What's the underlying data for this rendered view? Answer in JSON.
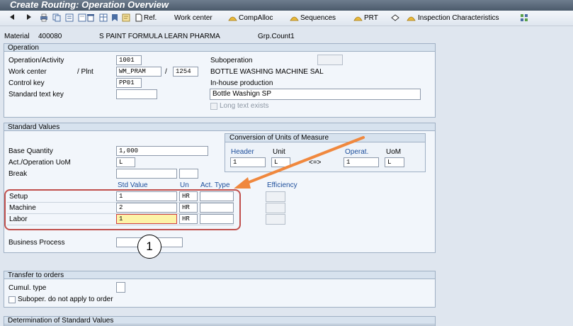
{
  "window": {
    "title": "Create Routing: Operation Overview"
  },
  "toolbar": {
    "ref_label": "Ref.",
    "work_center_label": "Work center",
    "compalloc_label": "CompAlloc",
    "sequences_label": "Sequences",
    "prt_label": "PRT",
    "inspection_label": "Inspection Characteristics"
  },
  "header": {
    "material_label": "Material",
    "material_value": "400080",
    "material_desc": "S PAINT FORMULA LEARN PHARMA",
    "grpcount_label": "Grp.Count1"
  },
  "operation": {
    "title": "Operation",
    "activity_label": "Operation/Activity",
    "activity_value": "1001",
    "suboperation_label": "Suboperation",
    "work_center_label": "Work center",
    "plnt_label": "/ Plnt",
    "work_center_value": "WM_PRAM",
    "slash": "/",
    "plant_value": "1254",
    "work_center_desc": "BOTTLE WASHING MACHINE SAL",
    "control_key_label": "Control key",
    "control_key_value": "PP01",
    "control_key_desc": "In-house production",
    "std_text_label": "Standard text key",
    "std_text_desc_value": "Bottle Washign SP",
    "long_text_label": "Long text exists"
  },
  "standard_values": {
    "title": "Standard Values",
    "base_qty_label": "Base Quantity",
    "base_qty_value": "1,000",
    "uom_label": "Act./Operation UoM",
    "uom_value": "L",
    "break_label": "Break",
    "conversion": {
      "title": "Conversion of Units of Measure",
      "header_label": "Header",
      "unit_label": "Unit",
      "operat_label": "Operat.",
      "uom_label": "UoM",
      "header_value": "1",
      "unit_value": "L",
      "arrow_symbol": "<=>",
      "operat_value": "1",
      "uom_value": "L"
    },
    "col_std_value": "Std Value",
    "col_un": "Un",
    "col_act_type": "Act. Type",
    "col_efficiency": "Efficiency",
    "rows": [
      {
        "label": "Setup",
        "value": "1",
        "unit": "HR"
      },
      {
        "label": "Machine",
        "value": "2",
        "unit": "HR"
      },
      {
        "label": "Labor",
        "value": "1",
        "unit": "HR"
      }
    ],
    "business_process_label": "Business Process"
  },
  "annotation": {
    "step_number": "1"
  },
  "transfer": {
    "title": "Transfer to orders",
    "cumul_label": "Cumul. type",
    "subop_label": "Suboper. do not apply to order"
  },
  "determination": {
    "title": "Determination of Standard Values"
  },
  "colors": {
    "accent_arrow": "#f0883e",
    "highlight_box": "#c0504d",
    "label_blue": "#1e4f9c"
  }
}
